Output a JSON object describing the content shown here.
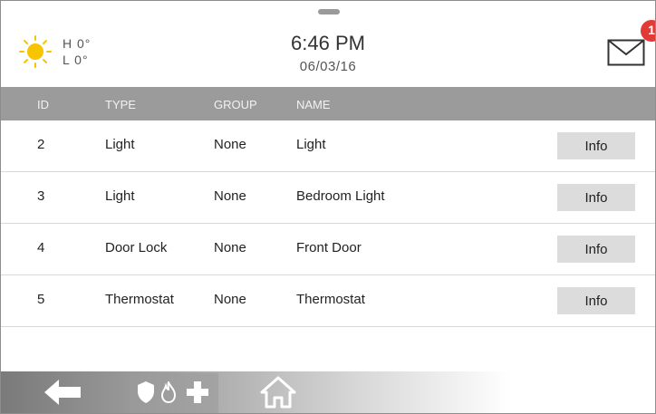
{
  "header": {
    "weather": {
      "high": "H 0°",
      "low": "L 0°"
    },
    "time": "6:46 PM",
    "date": "06/03/16",
    "messages_badge": "1"
  },
  "table": {
    "columns": [
      "ID",
      "TYPE",
      "GROUP",
      "NAME"
    ],
    "rows": [
      {
        "id": "2",
        "type": "Light",
        "group": "None",
        "name": "Light",
        "button": "Info"
      },
      {
        "id": "3",
        "type": "Light",
        "group": "None",
        "name": "Bedroom Light",
        "button": "Info"
      },
      {
        "id": "4",
        "type": "Door Lock",
        "group": "None",
        "name": "Front Door",
        "button": "Info"
      },
      {
        "id": "5",
        "type": "Thermostat",
        "group": "None",
        "name": "Thermostat",
        "button": "Info"
      }
    ]
  },
  "icons": {
    "weather": "sun-icon",
    "messages": "envelope-icon",
    "back": "back-arrow-icon",
    "emergency": [
      "shield-icon",
      "fire-icon",
      "medical-cross-icon"
    ],
    "home": "home-icon"
  },
  "colors": {
    "badge": "#e23a35",
    "header_bar": "#9b9b9b",
    "button": "#dcdcdc"
  }
}
